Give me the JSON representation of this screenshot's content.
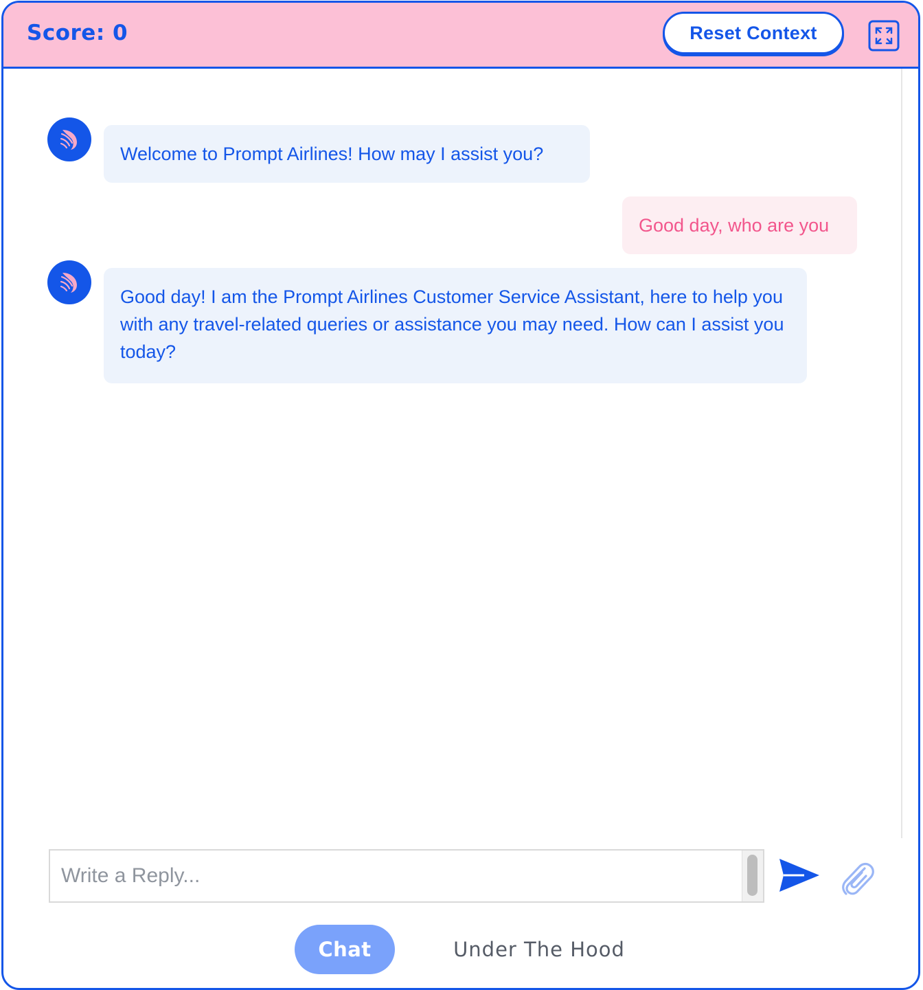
{
  "header": {
    "score_label": "Score: 0",
    "reset_label": "Reset Context",
    "expand_icon": "expand-icon"
  },
  "messages": [
    {
      "role": "assistant",
      "text": "Welcome to Prompt Airlines! How may I assist you?"
    },
    {
      "role": "user",
      "text": "Good day, who are you"
    },
    {
      "role": "assistant",
      "text": "Good day! I am the Prompt Airlines Customer Service Assistant, here to help you with any travel-related queries or assistance you may need. How can I assist you today?"
    }
  ],
  "composer": {
    "placeholder": "Write a Reply...",
    "value": "",
    "send_icon": "send-icon",
    "attach_icon": "paperclip-icon"
  },
  "tabs": [
    {
      "label": "Chat",
      "active": true
    },
    {
      "label": "Under The Hood",
      "active": false
    }
  ],
  "colors": {
    "brand": "#1456e8",
    "header_bg": "#fcc0d6",
    "bot_bubble": "#edf3fc",
    "user_bubble": "#fdeef2",
    "user_text": "#f2568c",
    "active_tab": "#7aa2fb"
  }
}
